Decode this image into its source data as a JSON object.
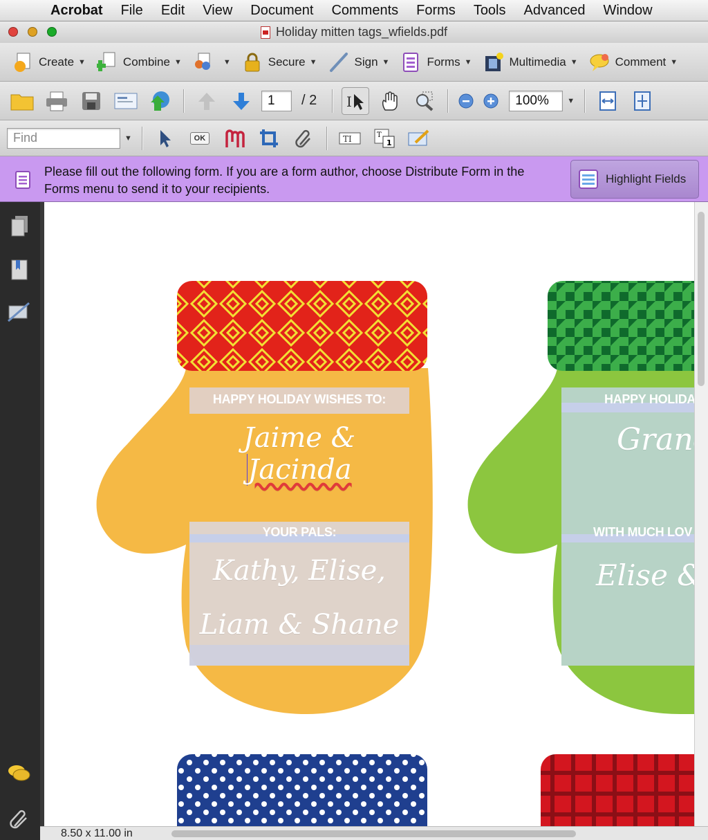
{
  "menubar": {
    "app": "Acrobat",
    "items": [
      "File",
      "Edit",
      "View",
      "Document",
      "Comments",
      "Forms",
      "Tools",
      "Advanced",
      "Window"
    ]
  },
  "window": {
    "title": "Holiday mitten tags_wfields.pdf"
  },
  "toolbar": {
    "create": "Create",
    "combine": "Combine",
    "secure": "Secure",
    "sign": "Sign",
    "forms": "Forms",
    "multimedia": "Multimedia",
    "comment": "Comment",
    "page_current": "1",
    "page_total": "/ 2",
    "zoom": "100%",
    "find_placeholder": "Find",
    "ok_label": "OK"
  },
  "formbar": {
    "message": "Please fill out the following form. If you are a form author, choose Distribute Form in the Forms menu to send it to your recipients.",
    "highlight": "Highlight Fields"
  },
  "mittens": {
    "m1": {
      "label_to": "HAPPY HOLIDAY WISHES TO:",
      "to_value_a": "Jaime & ",
      "to_value_b": "Jacinda",
      "label_from": "YOUR PALS:",
      "from_line1": "Kathy, Elise,",
      "from_line2": "Liam & Shane"
    },
    "m2": {
      "label_to": "HAPPY HOLIDA",
      "to_value": "Grandı",
      "label_from": "WITH MUCH LOV",
      "from_value": "Elise & S"
    }
  },
  "status": {
    "page_size": "8.50 x 11.00 in"
  },
  "colors": {
    "mitten_yellow": "#f5b945",
    "mitten_green": "#8cc63f",
    "cuff_red": "#e2231a",
    "cuff_green": "#1f8a3a",
    "cuff_blue": "#1f3f8f",
    "cuff_red_plaid": "#d3161f",
    "form_bar": "#c999f0"
  }
}
